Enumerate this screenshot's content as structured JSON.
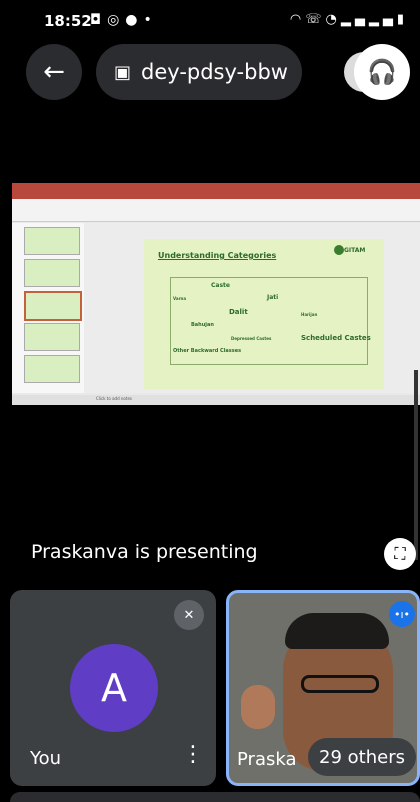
{
  "status_bar": {
    "time": "18:52",
    "left_icons": [
      "screen-record-icon",
      "whatsapp-icon",
      "facebook-icon",
      "dot-icon"
    ],
    "right_icons": [
      "headphones-icon",
      "volte-icon",
      "wifi-icon",
      "signal-icon",
      "signal-icon",
      "battery-icon"
    ]
  },
  "top_bar": {
    "meeting_code": "dey-pdsy-bbw"
  },
  "slide": {
    "title": "Understanding Categories",
    "logo_text": "GITAM",
    "terms": [
      "Caste",
      "Varna",
      "Jati",
      "Dalit",
      "Harijan",
      "Bahujan",
      "Depressed Castes",
      "Scheduled Castes",
      "Other Backward Classes"
    ],
    "notes_hint": "Click to add notes"
  },
  "presenting_text": "Praskanva is presenting",
  "tiles": {
    "you_initial": "A",
    "you_label": "You",
    "presenter_label": "Praska",
    "others_count": "29 others"
  },
  "colors": {
    "background": "#000000",
    "pill": "#2b2c2f",
    "tile": "#3c4043",
    "avatar": "#5f3dc4",
    "active_border": "#8ab4f8",
    "slide_bg": "#e4f2c4",
    "slide_text": "#2e6b29"
  }
}
